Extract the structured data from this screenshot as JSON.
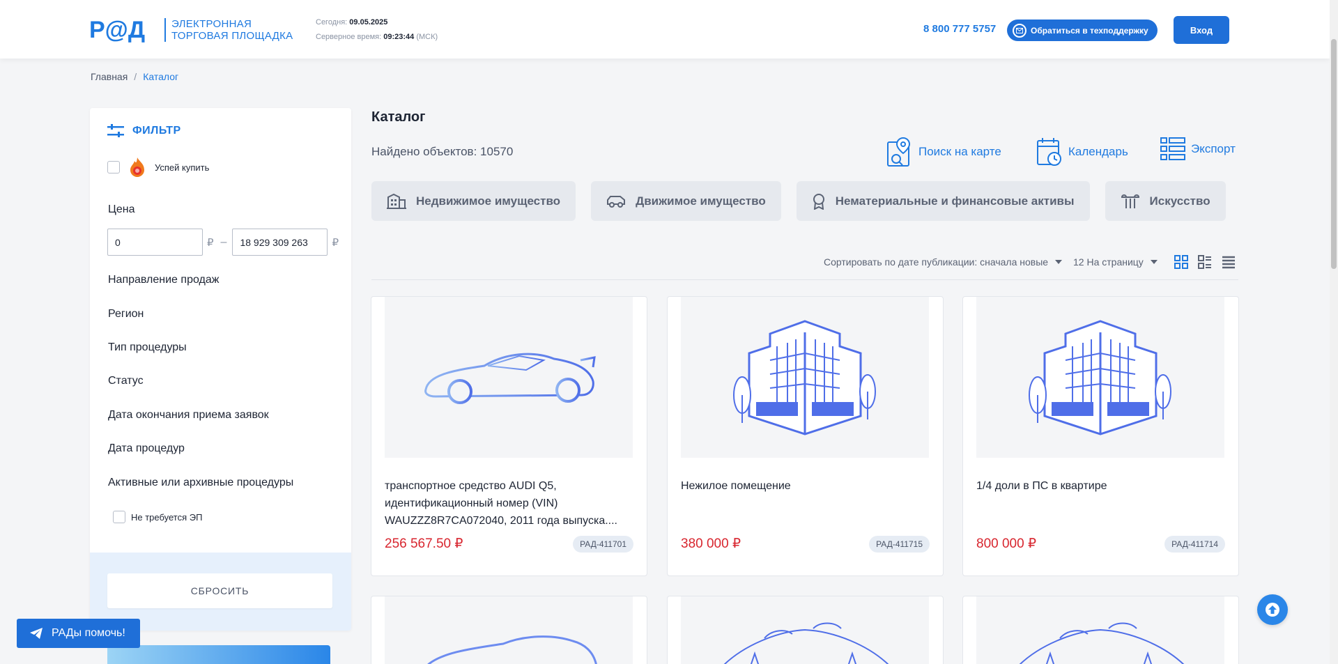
{
  "header": {
    "logo_text_line1": "ЭЛЕКТРОННАЯ",
    "logo_text_line2": "ТОРГОВАЯ ПЛОЩАДКА",
    "today_label": "Сегодня:",
    "today_value": "09.05.2025",
    "server_time_label": "Серверное время:",
    "server_time_value": "09:23:44",
    "timezone": "(МСК)",
    "phone": "8 800 777 5757",
    "support_label": "Обратиться в техподдержку",
    "login_label": "Вход"
  },
  "breadcrumb": {
    "home": "Главная",
    "separator": "/",
    "current": "Каталог"
  },
  "filter": {
    "title": "ФИЛЬТР",
    "hurry_label": "Успей купить",
    "price_label": "Цена",
    "price_from": "0",
    "price_to": "18 929 309 263",
    "currency": "₽",
    "range_dash": "–",
    "items": [
      "Направление продаж",
      "Регион",
      "Тип процедуры",
      "Статус",
      "Дата окончания приема заявок",
      "Дата процедур",
      "Активные или архивные процедуры"
    ],
    "no_ep_label": "Не требуется ЭП",
    "reset_label": "СБРОСИТЬ"
  },
  "help_button": "РАДы помочь!",
  "catalog": {
    "title": "Каталог",
    "found": "Найдено объектов: 10570",
    "tools": {
      "map": "Поиск на карте",
      "calendar": "Календарь",
      "export": "Экспорт"
    },
    "categories": [
      {
        "label": "Недвижимое имущество",
        "icon": "building-icon"
      },
      {
        "label": "Движимое имущество",
        "icon": "car-icon"
      },
      {
        "label": "Нематериальные и финансовые активы",
        "icon": "award-icon"
      },
      {
        "label": "Искусство",
        "icon": "column-icon"
      }
    ],
    "sort_label": "Сортировать по дате публикации: сначала новые",
    "per_page_label": "12 На страницу",
    "cards": [
      {
        "title": "транспортное средство AUDI Q5, идентификационный номер (VIN) WAUZZZ8R7CA072040, 2011 года выпуска....",
        "price": "256 567.50 ₽",
        "code": "РАД-411701",
        "image": "car-illustration"
      },
      {
        "title": "Нежилое помещение",
        "price": "380 000 ₽",
        "code": "РАД-411715",
        "image": "building-illustration"
      },
      {
        "title": "1/4 доли в ПС в квартире",
        "price": "800 000 ₽",
        "code": "РАД-411714",
        "image": "building-illustration"
      }
    ],
    "colors": {
      "accent": "#1f7ae0",
      "price": "#d8262f"
    }
  }
}
